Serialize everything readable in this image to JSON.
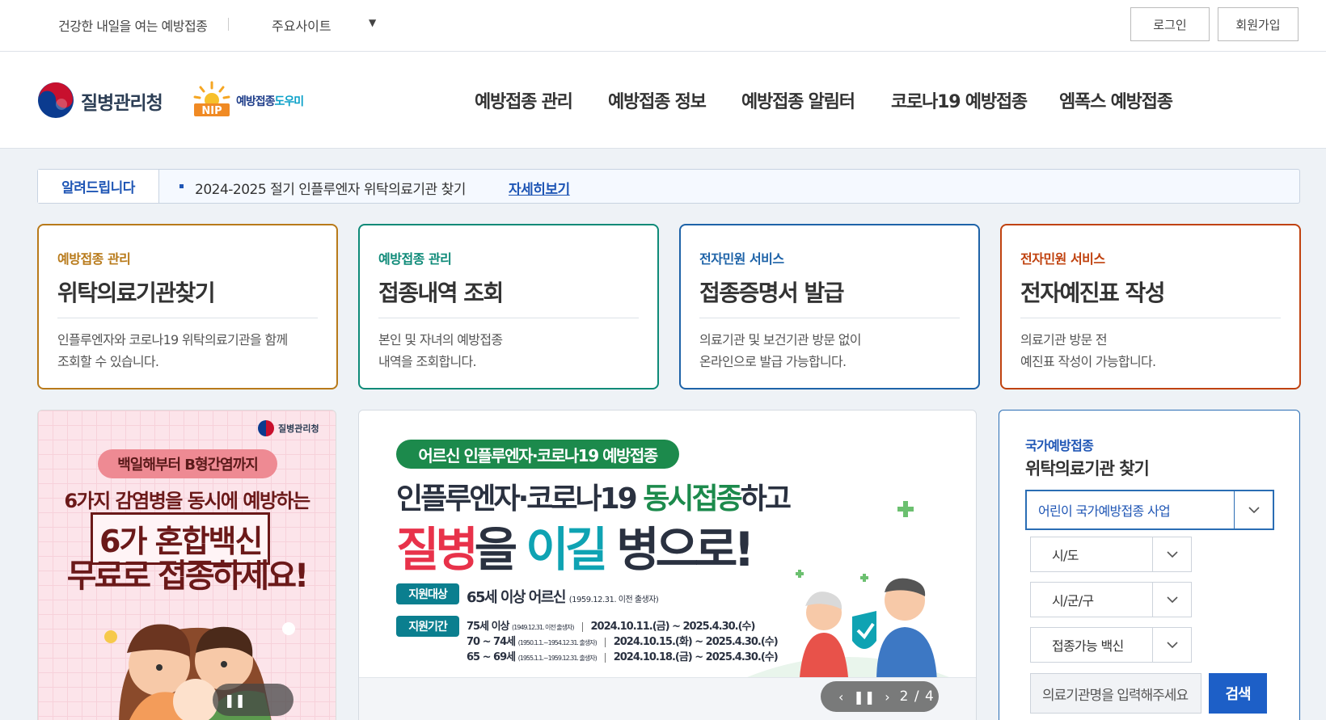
{
  "util": {
    "slogan": "건강한 내일을 여는 예방접종",
    "sites_label": "주요사이트",
    "sites_caret": "▼",
    "login": "로그인",
    "signup": "회원가입"
  },
  "header": {
    "kdca_name": "질병관리청",
    "nip_part1": "예방접종",
    "nip_part2": "도우미",
    "nip_badge": "NIP",
    "nav": [
      "예방접종 관리",
      "예방접종 정보",
      "예방접종 알림터",
      "코로나19 예방접종",
      "엠폭스 예방접종"
    ]
  },
  "notice": {
    "label": "알려드립니다",
    "text": "2024-2025 절기 인플루엔자 위탁의료기관 찾기",
    "link": "자세히보기"
  },
  "cards": [
    {
      "category": "예방접종 관리",
      "title": "위탁의료기관찾기",
      "desc1": "인플루엔자와 코로나19 위탁의료기관을 함께",
      "desc2": "조회할 수 있습니다.",
      "color": "#b87a1a"
    },
    {
      "category": "예방접종 관리",
      "title": "접종내역 조회",
      "desc1": "본인 및 자녀의 예방접종",
      "desc2": "내역을 조회합니다.",
      "color": "#0e8a78"
    },
    {
      "category": "전자민원 서비스",
      "title": "접종증명서 발급",
      "desc1": "의료기관 및 보건기관 방문 없이",
      "desc2": "온라인으로 발급 가능합니다.",
      "color": "#1e63a8"
    },
    {
      "category": "전자민원 서비스",
      "title": "전자예진표 작성",
      "desc1": "의료기관 방문 전",
      "desc2": "예진표 작성이 가능합니다.",
      "color": "#c0420f"
    }
  ],
  "banner_left": {
    "logo": "질병관리청",
    "pill": "백일해부터 B형간염까지",
    "line1": "6가지 감염병을 동시에 예방하는",
    "line2": "6가 혼합백신",
    "line3": "무료로 접종하세요!",
    "pause": "❚❚"
  },
  "banner_mid": {
    "pill": "어르신 인플루엔자·코로나19 예방접종",
    "h1_a": "인플루엔자·코로나19 ",
    "h1_b": "동시접종",
    "h1_c": "하고",
    "h2_a": "질병",
    "h2_b": "을 ",
    "h2_c": "이길",
    "h2_d": " 병으로!",
    "tag_target": "지원대상",
    "target": "65세 이상 어르신",
    "target_note": "(1959.12.31. 이전 출생자)",
    "tag_period": "지원기간",
    "rows": [
      {
        "age": "75세 이상",
        "born": "(1949.12.31. 이전 출생자)",
        "period": "2024.10.11.(금) ~ 2025.4.30.(수)"
      },
      {
        "age": "70 ~ 74세",
        "born": "(1950.1.1.~1954.12.31. 출생자)",
        "period": "2024.10.15.(화) ~ 2025.4.30.(수)"
      },
      {
        "age": "65 ~ 69세",
        "born": "(1955.1.1.~1959.12.31. 출생자)",
        "period": "2024.10.18.(금) ~ 2025.4.30.(수)"
      }
    ],
    "counter": "2 / 4"
  },
  "finder": {
    "category": "국가예방접종",
    "title": "위탁의료기관 찾기",
    "program": "어린이 국가예방접종 사업",
    "province": "시/도",
    "district": "시/군/구",
    "vaccine": "접종가능 백신",
    "input_placeholder": "의료기관명을 입력해주세요",
    "search": "검색"
  }
}
